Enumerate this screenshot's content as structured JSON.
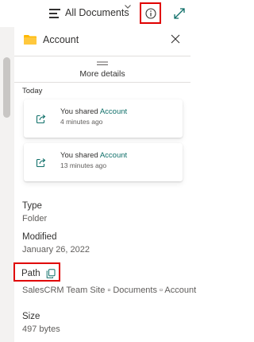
{
  "topbar": {
    "view_label": "All Documents",
    "icons": {
      "view": "view-list-icon",
      "chevron": "chevron-down-icon",
      "info": "info-icon",
      "expand": "expand-icon"
    }
  },
  "panel": {
    "title": "Account",
    "more_details_label": "More details",
    "icons": {
      "folder": "folder-icon",
      "close": "close-icon",
      "grip": "grip-icon"
    }
  },
  "activity": {
    "section_label": "Today",
    "items": [
      {
        "text": "You shared ",
        "link": "Account",
        "time": "4 minutes ago",
        "icon": "share-icon"
      },
      {
        "text": "You shared ",
        "link": "Account",
        "time": "13 minutes ago",
        "icon": "share-icon"
      }
    ]
  },
  "properties": {
    "type": {
      "label": "Type",
      "value": "Folder"
    },
    "modified": {
      "label": "Modified",
      "value": "January 26, 2022"
    },
    "path": {
      "label": "Path",
      "value": "SalesCRM Team Site ▫ Documents ▫ Account"
    },
    "size": {
      "label": "Size",
      "value": "497 bytes"
    }
  },
  "colors": {
    "accent_link": "#0f6f69",
    "highlight_box": "#e00000",
    "folder": "#ffb900"
  }
}
